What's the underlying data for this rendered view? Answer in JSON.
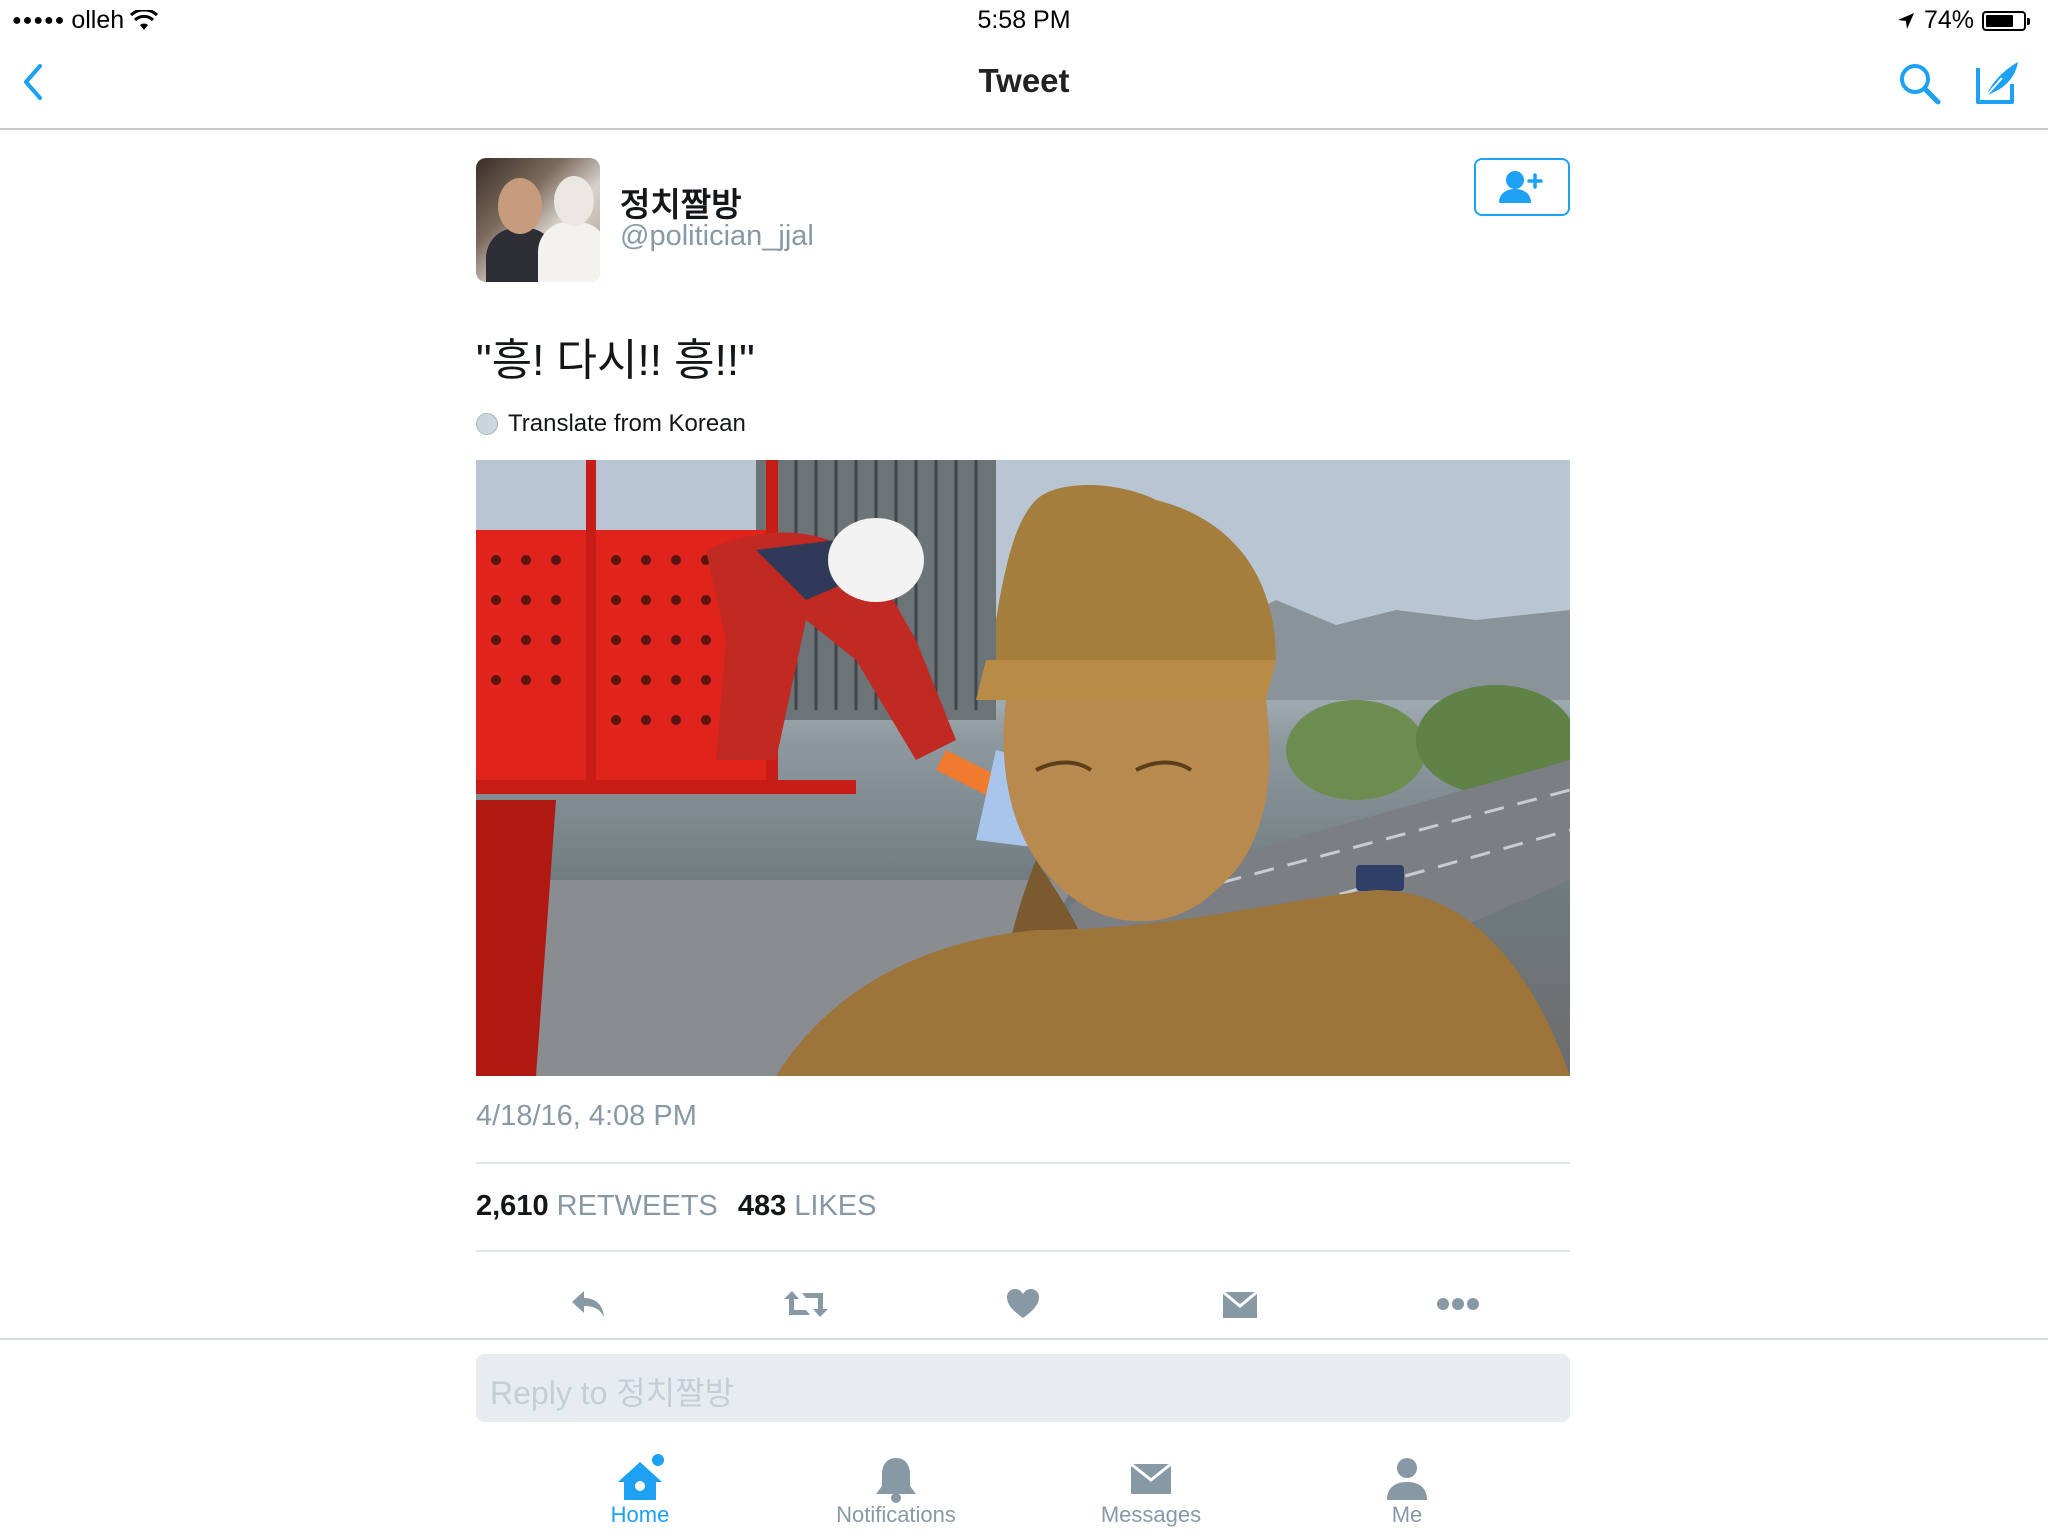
{
  "status_bar": {
    "carrier": "olleh",
    "time": "5:58 PM",
    "battery": "74%",
    "battery_level": 0.74
  },
  "nav": {
    "title": "Tweet",
    "back_icon": "chevron-left-icon",
    "search_icon": "search-icon",
    "compose_icon": "compose-icon"
  },
  "tweet": {
    "display_name": "정치짤방",
    "handle": "@politician_jjal",
    "text": "\"흥! 다시!! 흥!!\"",
    "translate_label": "Translate from Korean",
    "timestamp": "4/18/16, 4:08 PM",
    "retweets_count": "2,610",
    "retweets_label": "RETWEETS",
    "likes_count": "483",
    "likes_label": "LIKES"
  },
  "reply": {
    "placeholder": "Reply to 정치짤방"
  },
  "tabs": [
    {
      "label": "Home",
      "icon": "home-icon",
      "active": true
    },
    {
      "label": "Notifications",
      "icon": "bell-icon",
      "active": false
    },
    {
      "label": "Messages",
      "icon": "envelope-icon",
      "active": false
    },
    {
      "label": "Me",
      "icon": "person-icon",
      "active": false
    }
  ],
  "colors": {
    "accent": "#1da1f2",
    "muted": "#8899a6",
    "text": "#14171a"
  }
}
